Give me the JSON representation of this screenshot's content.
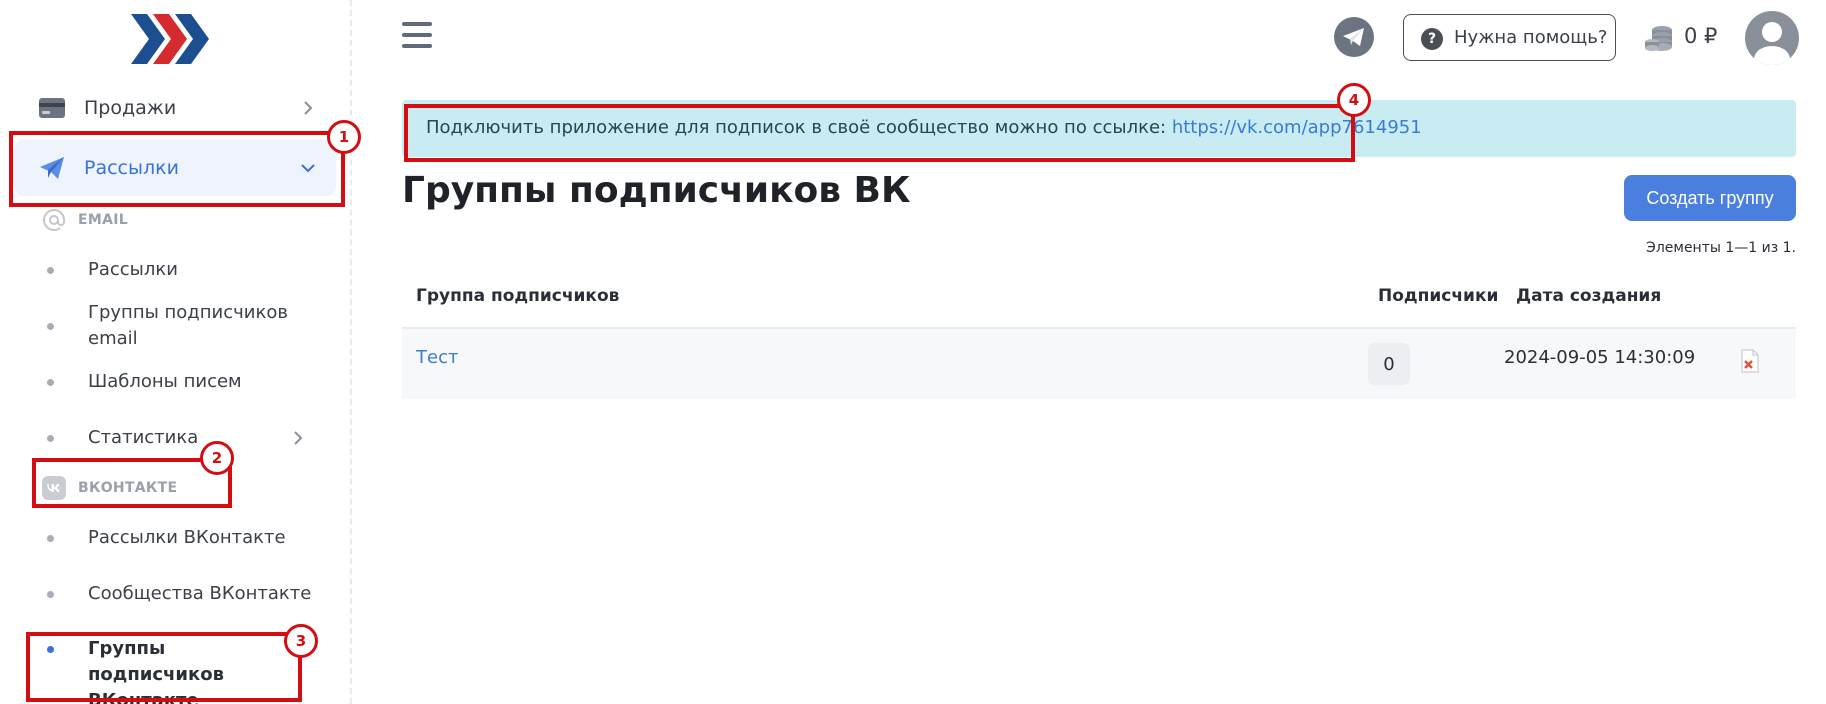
{
  "sidebar": {
    "items": [
      {
        "label": "Продажи"
      },
      {
        "label": "Рассылки"
      }
    ],
    "email_section": "EMAIL",
    "email_items": [
      {
        "label": "Рассылки"
      },
      {
        "label": "Группы подписчиков email"
      },
      {
        "label": "Шаблоны писем"
      },
      {
        "label": "Статистика"
      }
    ],
    "vk_section": "ВКОНТАКТЕ",
    "vk_items": [
      {
        "label": "Рассылки ВКонтакте"
      },
      {
        "label": "Сообщества ВКонтакте"
      },
      {
        "label": "Группы подписчиков ВКонтакте"
      }
    ]
  },
  "annotations": [
    "1",
    "2",
    "3",
    "4"
  ],
  "header": {
    "help_label": "Нужна помощь?",
    "help_icon_glyph": "?",
    "balance": "0 ₽"
  },
  "alert": {
    "text": "Подключить приложение для подписок в своё сообщество можно по ссылке: ",
    "link": "https://vk.com/app7614951"
  },
  "page": {
    "title": "Группы подписчиков ВК",
    "create_label": "Создать группу",
    "counter": "Элементы 1—1 из 1."
  },
  "table": {
    "headers": [
      "Группа подписчиков",
      "Подписчики",
      "Дата создания"
    ],
    "rows": [
      {
        "name": "Тест",
        "subscribers": "0",
        "created": "2024-09-05 14:30:09"
      }
    ]
  },
  "colors": {
    "accent": "#3b72d6",
    "primary_button": "#4a7fe0",
    "annotation_red": "#d40d12",
    "alert_bg": "#c8ecf1"
  }
}
